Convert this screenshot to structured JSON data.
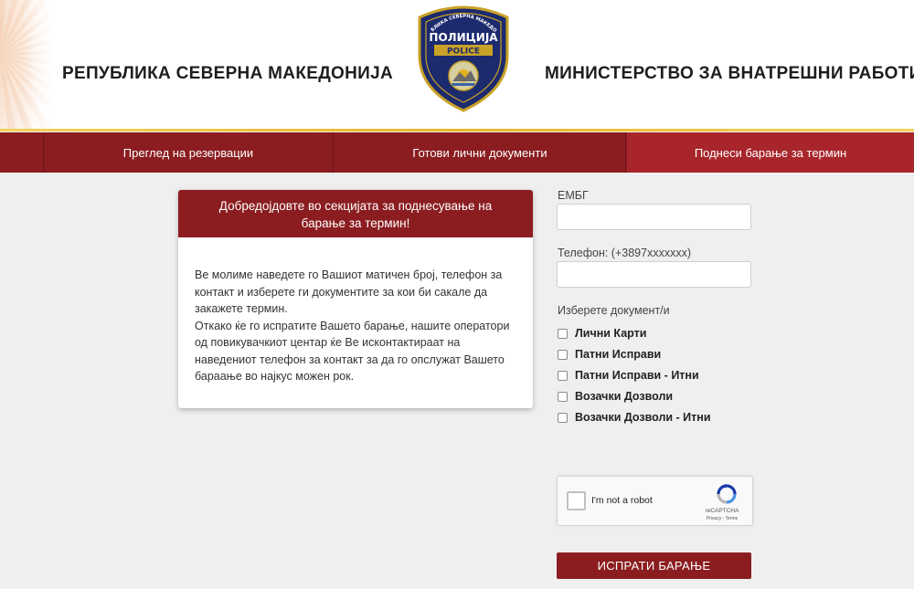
{
  "header": {
    "title_left": "РЕПУБЛИКА СЕВЕРНА МАКЕДОНИЈА",
    "title_right": "МИНИСТЕРСТВО ЗА ВНАТРЕШНИ РАБОТИ",
    "logo": {
      "top_text": "РЕПУБЛИКА СЕВЕРНА МАКЕДОНИЈА",
      "main_text": "ПОЛИЦИЈА",
      "sub_text": "POLICE"
    }
  },
  "nav": {
    "items": [
      {
        "label": "Преглед на резервации",
        "active": false
      },
      {
        "label": "Готови лични документи",
        "active": false
      },
      {
        "label": "Поднеси барање за термин",
        "active": true
      }
    ]
  },
  "info_card": {
    "title": "Добредојдовте во секцијата за поднесување на барање за термин!",
    "paragraph_1": "Ве молиме наведете го Вашиот матичен број, телефон за контакт и изберете ги документите за кои би сакале да закажете термин.",
    "paragraph_2": "Откако ќе го испратите Вашето барање, нашите оператори од повикувачкиот центар ќе Ве исконтактираат на наведениот телефон за контакт за да го опслужат Вашето бараање во најкус можен рок."
  },
  "form": {
    "embg_label": "ЕМБГ",
    "embg_value": "",
    "phone_label": "Телефон: (+3897xxxxxxx)",
    "phone_value": "",
    "documents_label": "Изберете документ/и",
    "documents": [
      {
        "label": "Лични Карти",
        "checked": false
      },
      {
        "label": "Патни Исправи",
        "checked": false
      },
      {
        "label": "Патни Исправи - Итни",
        "checked": false
      },
      {
        "label": "Возачки Дозволи",
        "checked": false
      },
      {
        "label": "Возачки Дозволи - Итни",
        "checked": false
      }
    ],
    "captcha": {
      "label": "I'm not a robot",
      "brand": "reCAPTCHA",
      "links": "Privacy - Terms"
    },
    "submit_label": "ИСПРАТИ БАРАЊЕ"
  },
  "colors": {
    "primary": "#8b1d20",
    "nav_active": "#a8262b",
    "header_line": "#e8b62a",
    "page_background": "#efefef"
  },
  "icons": [
    "police-badge-icon",
    "checkbox-icon",
    "recaptcha-icon"
  ]
}
